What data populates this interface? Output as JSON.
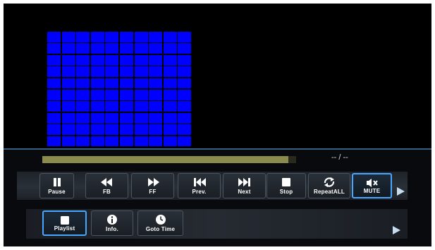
{
  "video": {
    "test_pattern": {
      "rows": 10,
      "columns": 10,
      "color": "#0000ff"
    }
  },
  "progress": {
    "fraction": 0.97,
    "time": "-- / --",
    "color": "#8a8b4c"
  },
  "playback_bar": {
    "buttons": [
      {
        "label": "Pause",
        "icon": "pause-icon"
      },
      {
        "label": "FB",
        "icon": "fast-backward-icon"
      },
      {
        "label": "FF",
        "icon": "fast-forward-icon"
      },
      {
        "label": "Prev.",
        "icon": "previous-icon"
      },
      {
        "label": "Next",
        "icon": "next-icon"
      },
      {
        "label": "Stop",
        "icon": "stop-icon"
      },
      {
        "label": "RepeatALL",
        "icon": "repeat-icon"
      },
      {
        "label": "MUTE",
        "icon": "mute-icon",
        "selected": true
      }
    ]
  },
  "function_bar": {
    "buttons": [
      {
        "label": "Playlist",
        "icon": "playlist-icon",
        "selected": true
      },
      {
        "label": "Info.",
        "icon": "info-icon"
      },
      {
        "label": "Goto Time",
        "icon": "clock-icon"
      }
    ]
  },
  "colors": {
    "accent": "#48a6ff",
    "panel": "#080a0d",
    "divider": "#3a5e80"
  }
}
